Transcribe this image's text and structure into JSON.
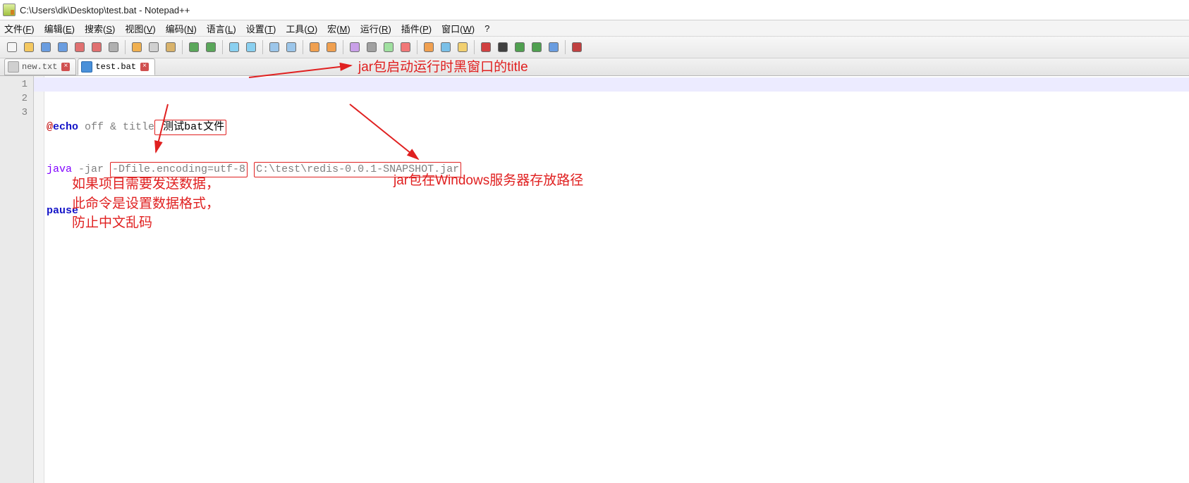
{
  "window": {
    "title": "C:\\Users\\dk\\Desktop\\test.bat - Notepad++"
  },
  "menu": {
    "items": [
      "文件(F)",
      "编辑(E)",
      "搜索(S)",
      "视图(V)",
      "编码(N)",
      "语言(L)",
      "设置(T)",
      "工具(O)",
      "宏(M)",
      "运行(R)",
      "插件(P)",
      "窗口(W)",
      "?"
    ]
  },
  "tabs": {
    "items": [
      {
        "label": "new.txt",
        "active": false,
        "icon": "gray"
      },
      {
        "label": "test.bat",
        "active": true,
        "icon": "blue"
      }
    ]
  },
  "gutter": {
    "lines": [
      "1",
      "2",
      "3"
    ]
  },
  "code": {
    "line1": {
      "at": "@",
      "echo": "echo",
      "off": " off & title",
      "box": " 测试bat文件"
    },
    "line2": {
      "java": "java",
      "jar": " -jar ",
      "box1": "-Dfile.encoding=utf-8",
      "sep": " ",
      "box2": "C:\\test\\redis-0.0.1-SNAPSHOT.jar"
    },
    "line3": {
      "pause": "pause"
    }
  },
  "annotations": {
    "a1": "jar包启动运行时黑窗口的title",
    "a2": "如果项目需要发送数据，\n此命令是设置数据格式，\n防止中文乱码",
    "a3": "jar包在Windows服务器存放路径"
  },
  "toolbar_icons": [
    "new-file-icon",
    "open-icon",
    "save-icon",
    "save-all-icon",
    "close-icon",
    "close-all-icon",
    "print-icon",
    "sep",
    "cut-icon",
    "copy-icon",
    "paste-icon",
    "sep",
    "undo-icon",
    "redo-icon",
    "sep",
    "find-icon",
    "replace-icon",
    "sep",
    "zoom-in-icon",
    "zoom-out-icon",
    "sep",
    "sync-v-icon",
    "sync-h-icon",
    "sep",
    "wrap-icon",
    "show-all-chars-icon",
    "indent-guide-icon",
    "lang-icon",
    "sep",
    "doc-map-icon",
    "func-list-icon",
    "folder-icon",
    "sep",
    "record-macro-icon",
    "stop-macro-icon",
    "play-macro-icon",
    "play-multi-icon",
    "save-macro-icon",
    "sep",
    "spell-check-icon"
  ]
}
